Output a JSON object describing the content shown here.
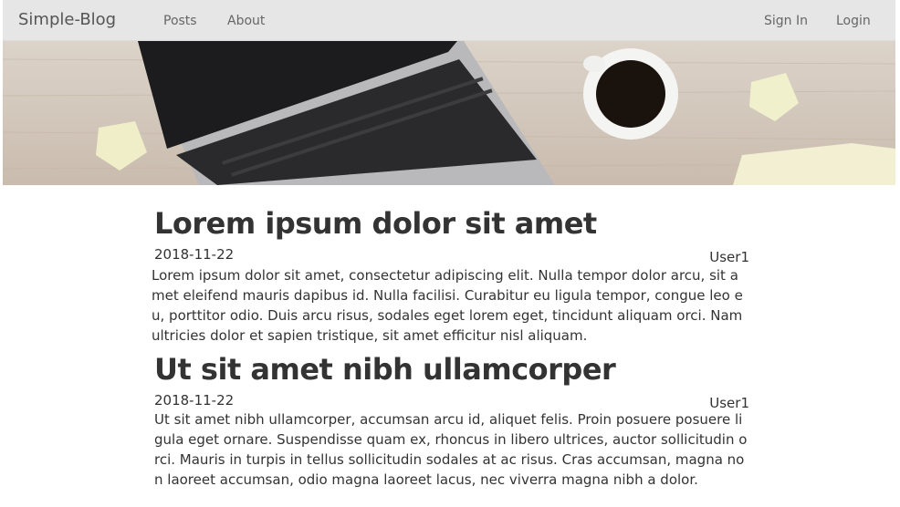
{
  "navbar": {
    "brand": "Simple-Blog",
    "links": [
      "Posts",
      "About"
    ],
    "right_links": [
      "Sign In",
      "Login"
    ]
  },
  "posts": [
    {
      "title": "Lorem ipsum dolor sit amet",
      "date": "2018-11-22",
      "author": "User1",
      "body": "Lorem ipsum dolor sit amet, consectetur adipiscing elit. Nulla tempor dolor arcu, sit amet eleifend mauris dapibus id. Nulla facilisi. Curabitur eu ligula tempor, congue leo eu, porttitor odio. Duis arcu risus, sodales eget lorem eget, tincidunt aliquam orci. Nam ultricies dolor et sapien tristique, sit amet efficitur nisl aliquam."
    },
    {
      "title": "Ut sit amet nibh ullamcorper",
      "date": "2018-11-22",
      "author": "User1",
      "body": "Ut sit amet nibh ullamcorper, accumsan arcu id, aliquet felis. Proin posuere posuere ligula eget ornare. Suspendisse quam ex, rhoncus in libero ultrices, auctor sollicitudin orci. Mauris in turpis in tellus sollicitudin sodales at ac risus. Cras accumsan, magna non laoreet accumsan, odio magna laoreet lacus, nec viverra magna nibh a dolor."
    }
  ]
}
